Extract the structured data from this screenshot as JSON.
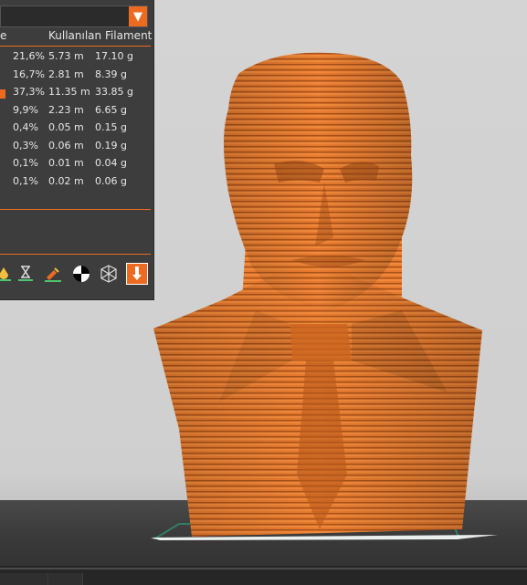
{
  "panel": {
    "header_left": "e",
    "header_filament": "Kullanılan Filament",
    "rows": [
      {
        "pct": "21,6%",
        "meters": "5.73 m",
        "grams": "17.10 g",
        "swatch": false
      },
      {
        "pct": "16,7%",
        "meters": "2.81 m",
        "grams": "8.39 g",
        "swatch": false
      },
      {
        "pct": "37,3%",
        "meters": "11.35 m",
        "grams": "33.85 g",
        "swatch": true
      },
      {
        "pct": "9,9%",
        "meters": "2.23 m",
        "grams": "6.65 g",
        "swatch": false
      },
      {
        "pct": "0,4%",
        "meters": "0.05 m",
        "grams": "0.15 g",
        "swatch": false
      },
      {
        "pct": "0,3%",
        "meters": "0.06 m",
        "grams": "0.19 g",
        "swatch": false
      },
      {
        "pct": "0,1%",
        "meters": "0.01 m",
        "grams": "0.04 g",
        "swatch": false
      },
      {
        "pct": "0,1%",
        "meters": "0.02 m",
        "grams": "0.06 g",
        "swatch": false
      }
    ],
    "dropdown_arrow": "▼"
  },
  "toolbar": {
    "icons": [
      "color-drop-icon",
      "hourglass-icon",
      "paint-brush-icon",
      "half-circle-icon",
      "cube-outline-icon",
      "download-arrow-icon"
    ]
  },
  "colors": {
    "accent": "#ed6b21",
    "model": "#e67a2e",
    "panel_bg": "#3d3d3d"
  }
}
